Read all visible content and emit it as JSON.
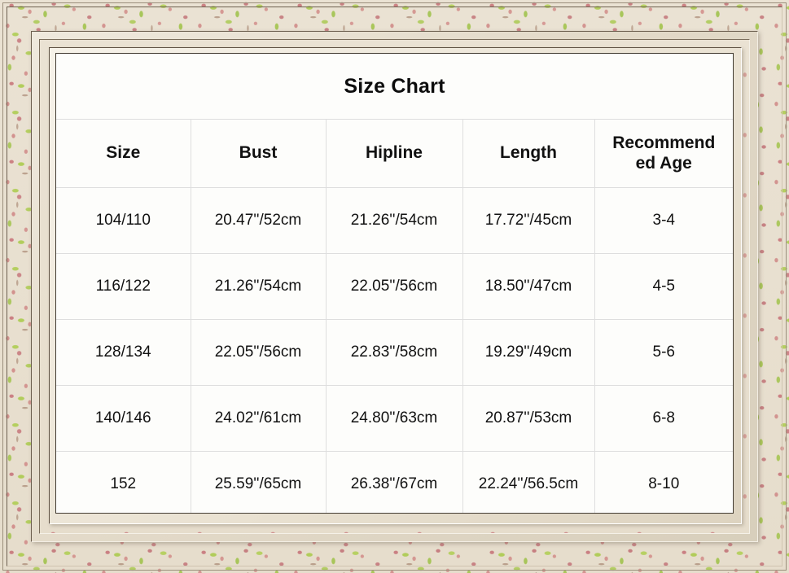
{
  "title": "Size Chart",
  "table": {
    "headers": [
      "Size",
      "Bust",
      "Hipline",
      "Recommended Age",
      "Length"
    ],
    "columns": {
      "size": "Size",
      "bust": "Bust",
      "hipline": "Hipline",
      "length": "Length",
      "recommended_age_line1": "Recommend",
      "recommended_age_line2": "ed Age"
    },
    "rows": [
      {
        "size": "104/110",
        "bust": "20.47''/52cm",
        "hipline": "21.26''/54cm",
        "length": "17.72''/45cm",
        "age": "3-4"
      },
      {
        "size": "116/122",
        "bust": "21.26''/54cm",
        "hipline": "22.05''/56cm",
        "length": "18.50''/47cm",
        "age": "4-5"
      },
      {
        "size": "128/134",
        "bust": "22.05''/56cm",
        "hipline": "22.83''/58cm",
        "length": "19.29''/49cm",
        "age": "5-6"
      },
      {
        "size": "140/146",
        "bust": "24.02''/61cm",
        "hipline": "24.80''/63cm",
        "length": "20.87''/53cm",
        "age": "6-8"
      },
      {
        "size": "152",
        "bust": "25.59''/65cm",
        "hipline": "26.38''/67cm",
        "length": "22.24''/56.5cm",
        "age": "8-10"
      }
    ]
  },
  "colors": {
    "card_background": "#fdfdfb",
    "card_border": "#3f382e",
    "grid_line": "#dedede",
    "text": "#111111",
    "frame_paper": "#e9e1d2",
    "floral_rose": "#c67076",
    "floral_green": "#a4c83e",
    "floral_stem": "#966e58"
  }
}
